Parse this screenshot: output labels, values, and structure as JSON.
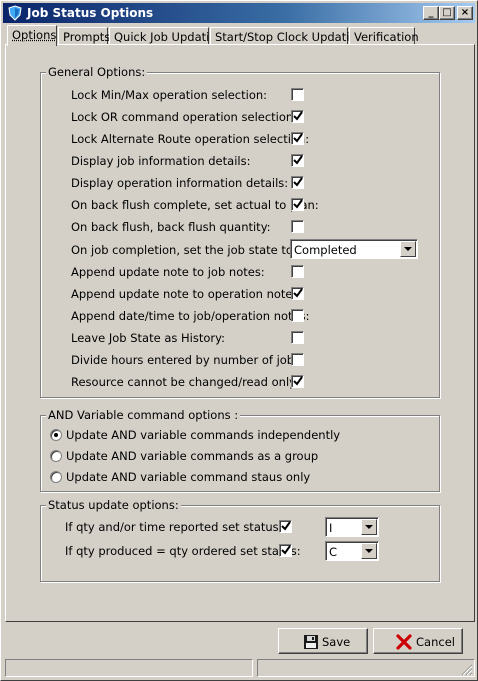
{
  "window": {
    "title": "Job Status Options"
  },
  "titlebar_buttons": {
    "minimize": "_",
    "maximize": "□",
    "close": "×"
  },
  "tabs": [
    {
      "label": "Options",
      "active": true
    },
    {
      "label": "Prompts",
      "active": false
    },
    {
      "label": "Quick Job Updating",
      "active": false
    },
    {
      "label": "Start/Stop Clock Updating",
      "active": false
    },
    {
      "label": "Verification",
      "active": false
    }
  ],
  "general_options": {
    "legend": "General Options:",
    "items": [
      {
        "label": "Lock Min/Max operation selection:",
        "checked": false
      },
      {
        "label": "Lock OR command operation selection:",
        "checked": true
      },
      {
        "label": "Lock Alternate Route operation selection:",
        "checked": true
      },
      {
        "label": "Display job information details:",
        "checked": true
      },
      {
        "label": "Display operation information details:",
        "checked": true
      },
      {
        "label": "On back flush complete, set actual to plan:",
        "checked": true
      },
      {
        "label": "On back flush, back flush quantity:",
        "checked": false
      },
      {
        "label": "On job completion, set the job state to:",
        "select": "Completed"
      },
      {
        "label": "Append update note to job notes:",
        "checked": false
      },
      {
        "label": "Append update note to operation notes:",
        "checked": true
      },
      {
        "label": "Append date/time to job/operation notes:",
        "checked": false
      },
      {
        "label": "Leave Job State as History:",
        "checked": false
      },
      {
        "label": "Divide hours entered by number of jobs:",
        "checked": false
      },
      {
        "label": "Resource cannot be changed/read only:",
        "checked": true
      }
    ]
  },
  "and_variable": {
    "legend": "AND Variable command options :",
    "options": [
      {
        "label": "Update AND variable commands independently",
        "selected": true
      },
      {
        "label": "Update AND variable commands as a group",
        "selected": false
      },
      {
        "label": "Update AND variable command staus only",
        "selected": false
      }
    ]
  },
  "status_update": {
    "legend": "Status update options:",
    "rows": [
      {
        "label": "If qty and/or time reported set status:",
        "checked": true,
        "status": "I"
      },
      {
        "label": "If qty produced = qty ordered set status:",
        "checked": true,
        "status": "C"
      }
    ]
  },
  "buttons": {
    "save": "Save",
    "cancel": "Cancel"
  },
  "colors": {
    "title_bar": "#0a246a",
    "face": "#d4d0c8",
    "cancel_x": "#cc0000"
  }
}
